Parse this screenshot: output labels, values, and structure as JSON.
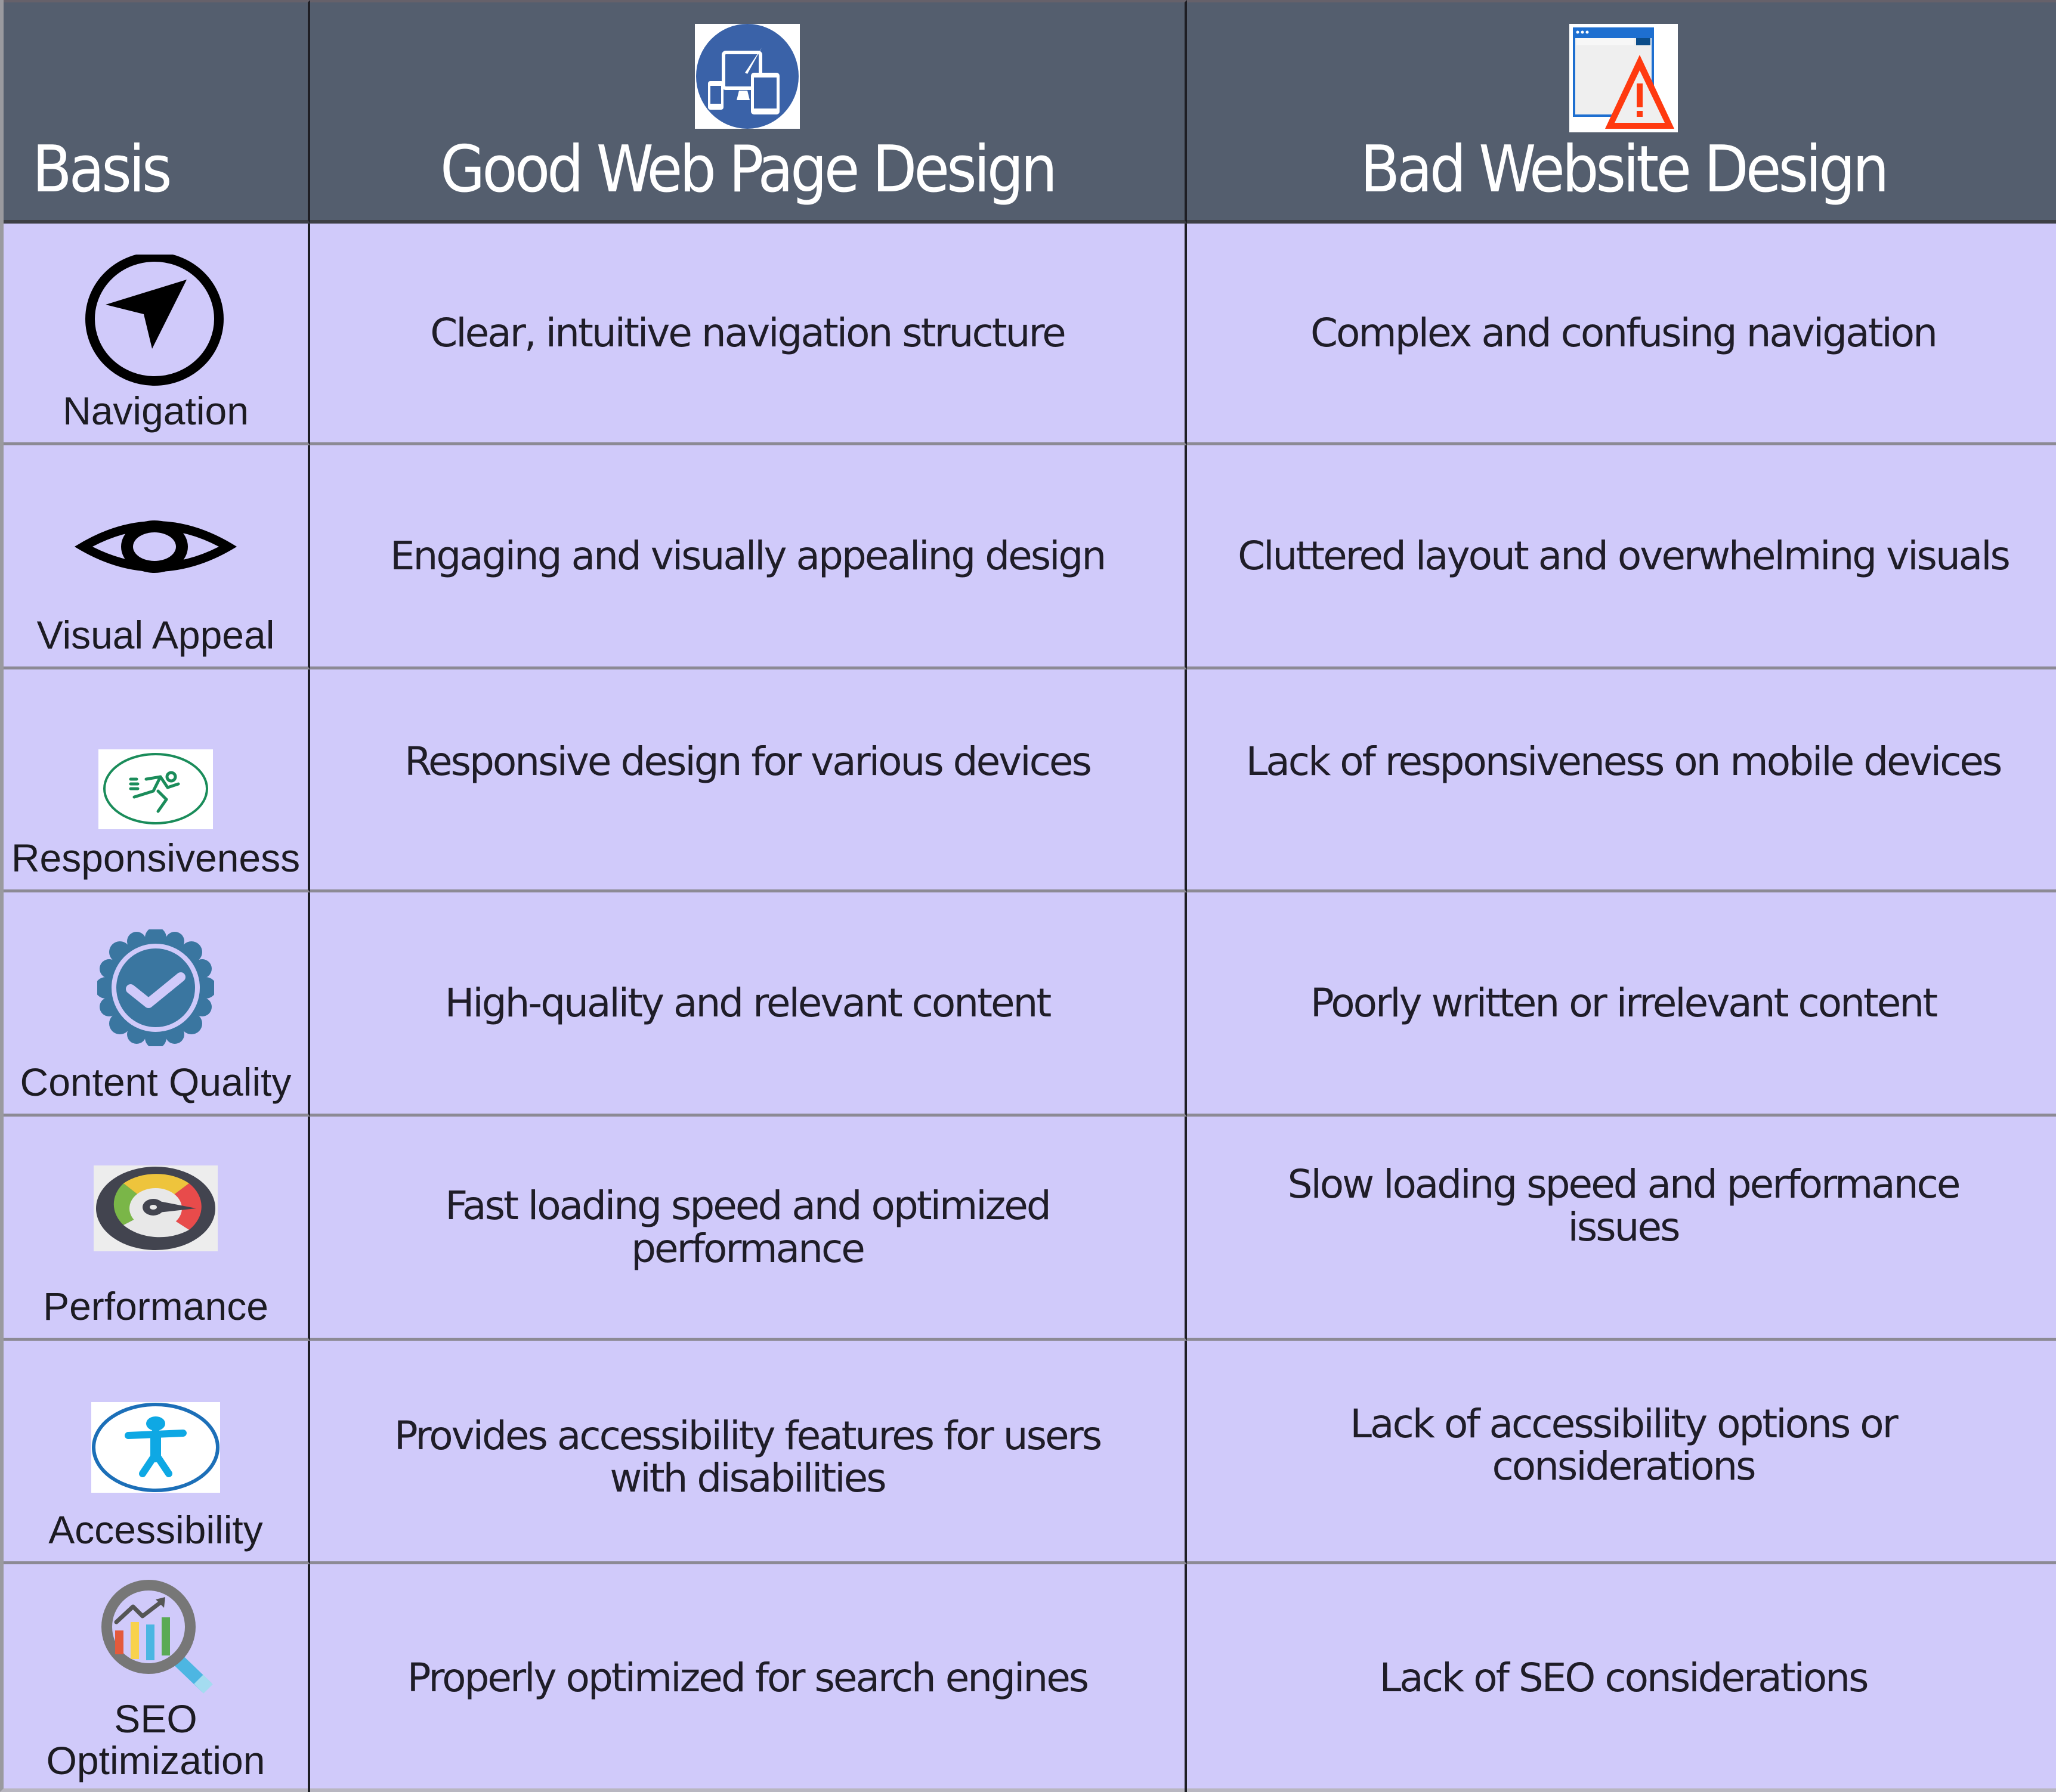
{
  "header": {
    "basis": "Basis",
    "good": "Good Web Page Design",
    "bad": "Bad Website Design",
    "good_icon": "responsive-devices-icon",
    "bad_icon": "browser-warning-icon"
  },
  "colors": {
    "header_bg": "#545e6e",
    "row_bg": "#d0cafa",
    "header_text": "#ffffff",
    "body_text": "#1f1d28"
  },
  "rows": [
    {
      "basis": "Navigation",
      "icon": "navigation-arrow-icon",
      "good": "Clear, intuitive navigation structure",
      "bad": "Complex and confusing navigation"
    },
    {
      "basis": "Visual Appeal",
      "icon": "eye-icon",
      "good": "Engaging and visually appealing design",
      "bad": "Cluttered layout and overwhelming visuals"
    },
    {
      "basis": "Responsiveness",
      "icon": "running-person-icon",
      "good": "Responsive design for various devices",
      "bad": "Lack of responsiveness on mobile devices"
    },
    {
      "basis": "Content Quality",
      "icon": "verified-badge-icon",
      "good": "High-quality and relevant content",
      "bad": "Poorly written or irrelevant content"
    },
    {
      "basis": "Performance",
      "icon": "speedometer-icon",
      "good": "Fast loading speed and optimized performance",
      "bad": "Slow loading speed and performance issues"
    },
    {
      "basis": "Accessibility",
      "icon": "accessibility-person-icon",
      "good": "Provides accessibility features for users with disabilities",
      "bad": "Lack of accessibility options or considerations"
    },
    {
      "basis": "SEO\nOptimization",
      "icon": "seo-magnifier-chart-icon",
      "good": "Properly optimized for search engines",
      "bad": "Lack of SEO considerations"
    }
  ]
}
